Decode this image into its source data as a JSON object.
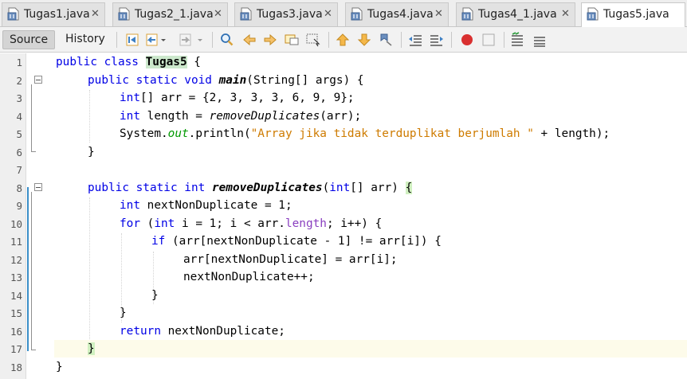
{
  "tabs": [
    {
      "label": "Tugas1.java",
      "active": false
    },
    {
      "label": "Tugas2_1.java",
      "active": false
    },
    {
      "label": "Tugas3.java",
      "active": false
    },
    {
      "label": "Tugas4.java",
      "active": false
    },
    {
      "label": "Tugas4_1.java",
      "active": false
    },
    {
      "label": "Tugas5.java",
      "active": true
    }
  ],
  "close_glyph": "✕",
  "toolbar": {
    "source_label": "Source",
    "history_label": "History"
  },
  "line_numbers": [
    "1",
    "2",
    "3",
    "4",
    "5",
    "6",
    "7",
    "8",
    "9",
    "10",
    "11",
    "12",
    "13",
    "14",
    "15",
    "16",
    "17",
    "18"
  ],
  "code": {
    "l1": {
      "kw": "public class ",
      "name": "Tugas5",
      "rest": " {"
    },
    "l2": {
      "kw": "public static void ",
      "method": "main",
      "rest": "(String[] args) {"
    },
    "l3": {
      "kw": "int",
      "rest": "[] arr = {2, 3, 3, 3, 6, 9, 9};"
    },
    "l4": {
      "kw": "int",
      "rest": " length = ",
      "call": "removeDuplicates",
      "rest2": "(arr);"
    },
    "l5": {
      "pre": "System.",
      "field": "out",
      "mid": ".println(",
      "str": "\"Array jika tidak terduplikat berjumlah \"",
      "rest": " + length);"
    },
    "l6": {
      "text": "}"
    },
    "l8": {
      "kw": "public static int ",
      "method": "removeDuplicates",
      "p1": "(",
      "kw2": "int",
      "p2": "[] arr) ",
      "brace": "{"
    },
    "l9": {
      "kw": "int",
      "rest": " nextNonDuplicate = 1;"
    },
    "l10": {
      "kw": "for",
      "p1": " (",
      "kw2": "int",
      "p2": " i = 1; i < arr.",
      "field": "length",
      "p3": "; i++) {"
    },
    "l11": {
      "kw": "if",
      "rest": " (arr[nextNonDuplicate - 1] != arr[i]) {"
    },
    "l12": {
      "text": "arr[nextNonDuplicate] = arr[i];"
    },
    "l13": {
      "text": "nextNonDuplicate++;"
    },
    "l14": {
      "text": "}"
    },
    "l15": {
      "text": "}"
    },
    "l16": {
      "kw": "return",
      "rest": " nextNonDuplicate;"
    },
    "l17": {
      "text": "}"
    },
    "l18": {
      "text": "}"
    }
  },
  "colors": {
    "keyword": "#0000e6",
    "string": "#ce7b00",
    "field": "#009900",
    "class_highlight": "#cce8cc",
    "current_line": "#fdfbea"
  }
}
